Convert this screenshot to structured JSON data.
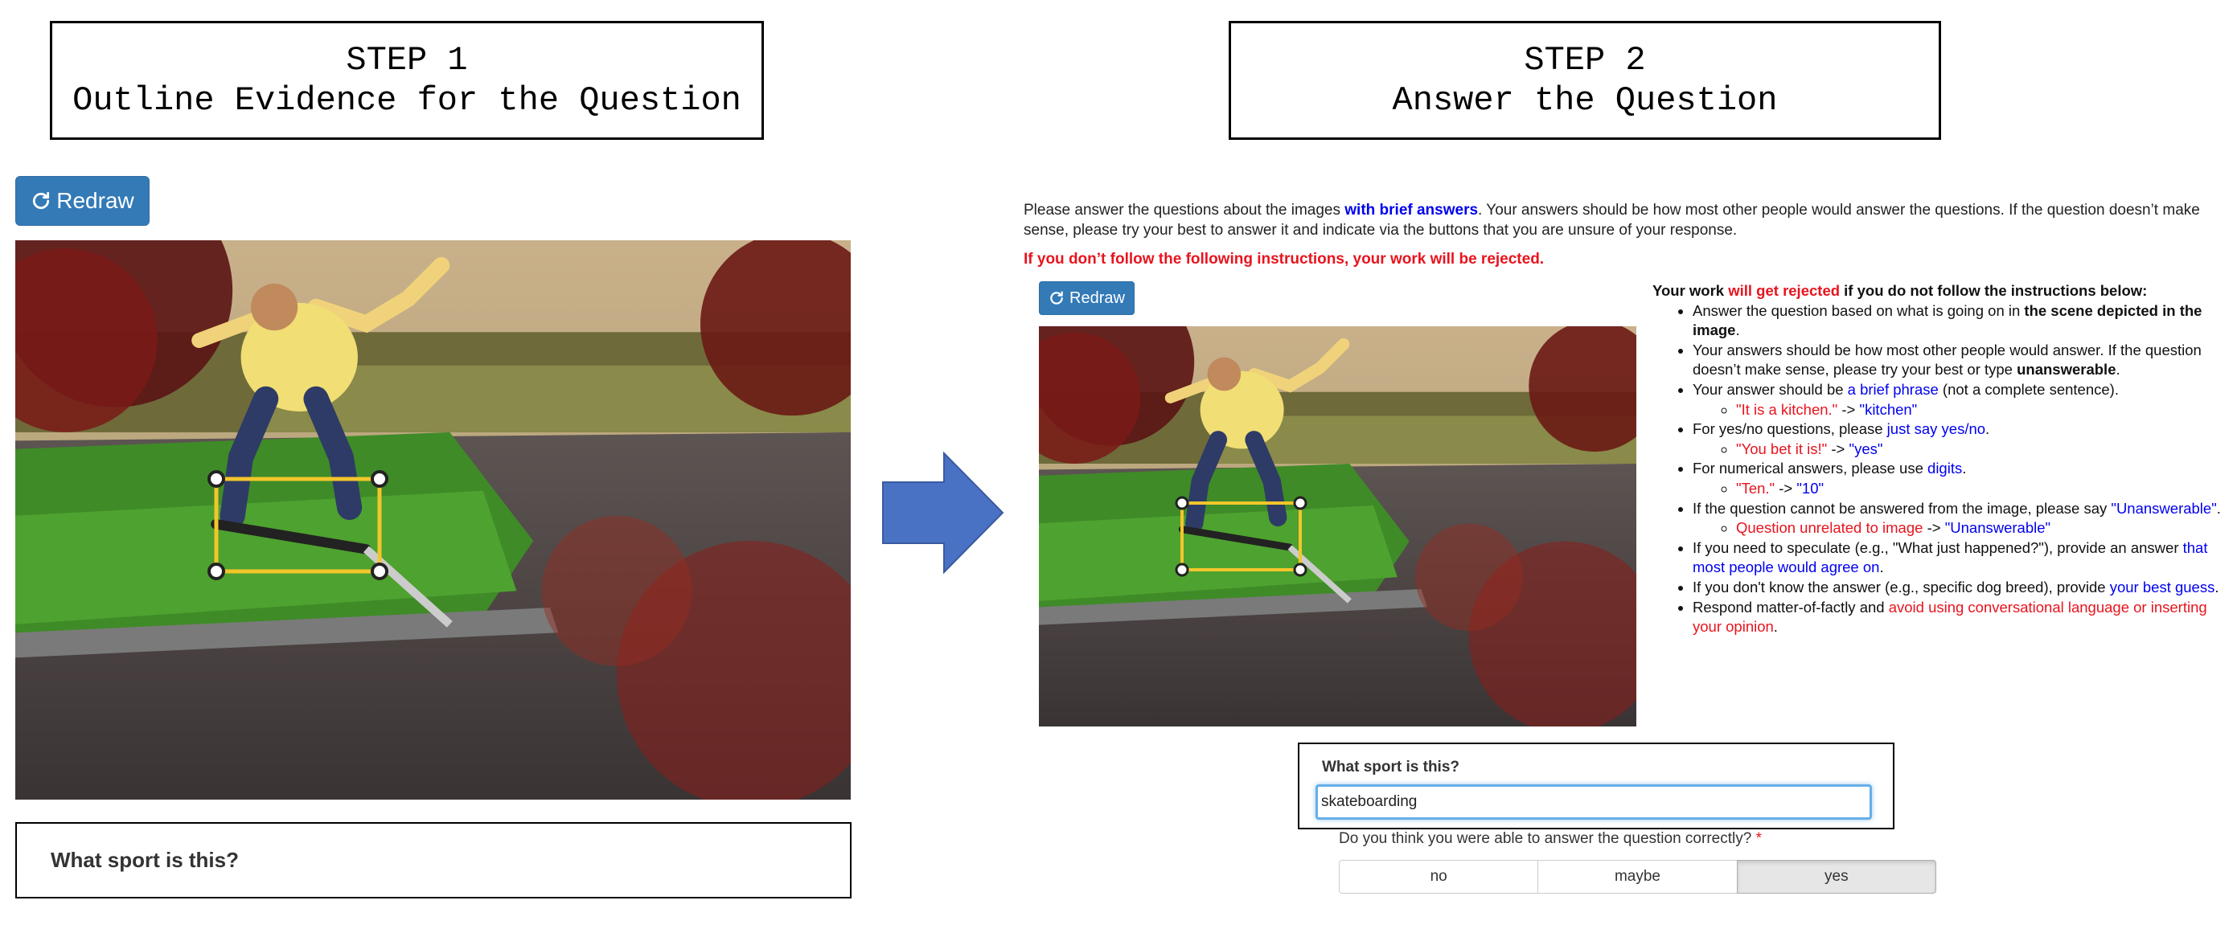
{
  "step1": {
    "line1": "STEP 1",
    "line2": "Outline Evidence for the Question"
  },
  "step2": {
    "line1": "STEP 2",
    "line2": "Answer the Question"
  },
  "left": {
    "redraw_label": "Redraw",
    "question": "What sport is this?"
  },
  "right": {
    "intro": {
      "part1": "Please answer the questions about the images ",
      "emph": "with brief answers",
      "part2": ". Your answers should be how most other people would answer the questions. If the question doesn’t make sense, please try your best to answer it and indicate via the buttons that you are unsure of your response."
    },
    "warning": "If you don’t follow the following instructions, your work will be rejected.",
    "redraw_label": "Redraw",
    "rules": {
      "head1": "Your work ",
      "head2": "will get rejected",
      "head3": " if you do not follow the instructions below:",
      "r1a": "Answer the question based on what is going on in ",
      "r1b": "the scene depicted in the image",
      "r1c": ".",
      "r2a": "Your answers should be how most other people would answer. If the question doesn’t make sense, please try your best or type ",
      "r2b": "unanswerable",
      "r2c": ".",
      "r3a": "Your answer should be ",
      "r3b": "a brief phrase",
      "r3c": " (not a complete sentence).",
      "r3ex_a": "\"It is a kitchen.\"",
      "r3ex_arrow": " -> ",
      "r3ex_b": "\"kitchen\"",
      "r4a": "For yes/no questions, please ",
      "r4b": "just say yes/no",
      "r4c": ".",
      "r4ex_a": "\"You bet it is!\"",
      "r4ex_arrow": " -> ",
      "r4ex_b": "\"yes\"",
      "r5a": "For numerical answers, please use ",
      "r5b": "digits",
      "r5c": ".",
      "r5ex_a": "\"Ten.\"",
      "r5ex_arrow": " -> ",
      "r5ex_b": "\"10\"",
      "r6a": "If the question cannot be answered from the image, please say ",
      "r6b": "\"Unanswerable\"",
      "r6c": ".",
      "r6ex_a": "Question unrelated to image",
      "r6ex_arrow": " -> ",
      "r6ex_b": "\"Unanswerable\"",
      "r7a": "If you need to speculate (e.g., \"What just happened?\"), provide an answer ",
      "r7b": "that most people would agree on",
      "r7c": ".",
      "r8a": "If you don't know the answer (e.g., specific dog breed), provide ",
      "r8b": "your best guess",
      "r8c": ".",
      "r9a": "Respond matter-of-factly and ",
      "r9b": "avoid using conversational language or inserting your opinion",
      "r9c": "."
    },
    "answer_question": "What sport is this?",
    "answer_value": "skateboarding",
    "confidence_question": "Do you think you were able to answer the question correctly?",
    "confidence_star": "*",
    "options": [
      "no",
      "maybe",
      "yes"
    ],
    "selected_option": "yes"
  },
  "colors": {
    "button_blue": "#337ab7",
    "arrow_blue": "#4a72c4",
    "instruction_red": "#e8141e",
    "instruction_blue": "#0000ee",
    "evidence_box": "#f2c62b"
  },
  "icons": [
    "redraw-icon",
    "right-arrow-icon",
    "drag-handle-icon"
  ]
}
